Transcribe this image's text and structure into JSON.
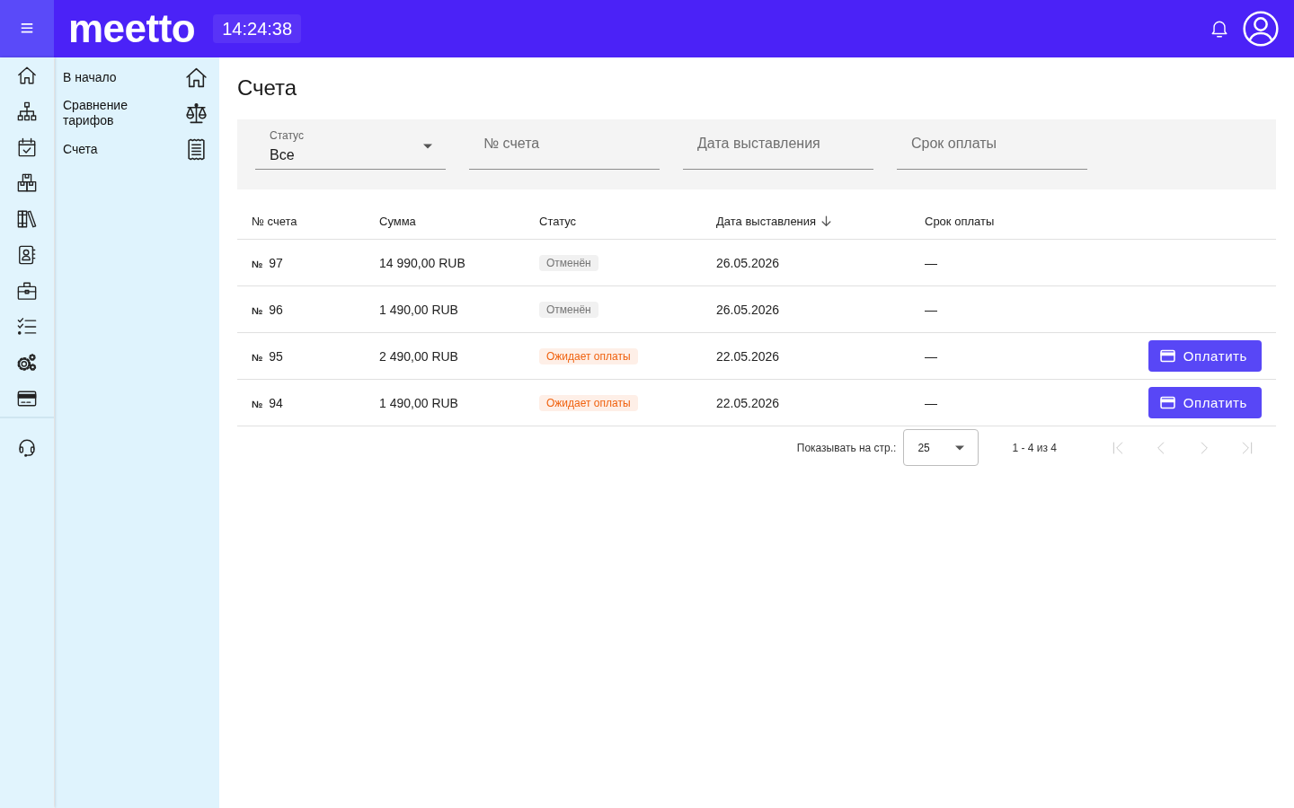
{
  "header": {
    "logo": "meetto",
    "clock": "14:24:38"
  },
  "sidebar": {
    "items": [
      {
        "label": "В начало"
      },
      {
        "label": "Сравнение тарифов"
      },
      {
        "label": "Счета"
      }
    ]
  },
  "page": {
    "title": "Счета"
  },
  "filters": [
    {
      "kind": "select",
      "label": "Статус",
      "value": "Все"
    },
    {
      "kind": "text",
      "placeholder": "№ счета"
    },
    {
      "kind": "text",
      "placeholder": "Дата выставления"
    },
    {
      "kind": "text",
      "placeholder": "Срок оплаты"
    }
  ],
  "table": {
    "columns": [
      {
        "label": "№ счета",
        "sorted": false
      },
      {
        "label": "Сумма",
        "sorted": false
      },
      {
        "label": "Статус",
        "sorted": false
      },
      {
        "label": "Дата выставления",
        "sorted": true
      },
      {
        "label": "Срок оплаты",
        "sorted": false
      }
    ],
    "rows": [
      {
        "number": "**№** 97",
        "amount": "14 990,00 RUB",
        "status": {
          "label": "Отменён",
          "color": "#757575"
        },
        "issued": "26.05.2026",
        "due": "—"
      },
      {
        "number": "**№** 96",
        "amount": "1 490,00 RUB",
        "status": {
          "label": "Отменён",
          "color": "#757575"
        },
        "issued": "26.05.2026",
        "due": "—"
      },
      {
        "number": "**№** 95",
        "amount": "2 490,00 RUB",
        "status": {
          "label": "Ожидает оплаты",
          "color": "#f0620f"
        },
        "issued": "22.05.2026",
        "due": "—",
        "action": "Оплатить"
      },
      {
        "number": "**№** 94",
        "amount": "1 490,00 RUB",
        "status": {
          "label": "Ожидает оплаты",
          "color": "#f0620f"
        },
        "issued": "22.05.2026",
        "due": "—",
        "action": "Оплатить"
      }
    ]
  },
  "pagination": {
    "page_size_label": "Показывать на стр.:",
    "page_size": "25",
    "range": "1 - 4 из 4",
    "nav": [
      {
        "disabled": true
      },
      {
        "disabled": true
      },
      {
        "disabled": true
      },
      {
        "disabled": true
      }
    ]
  }
}
